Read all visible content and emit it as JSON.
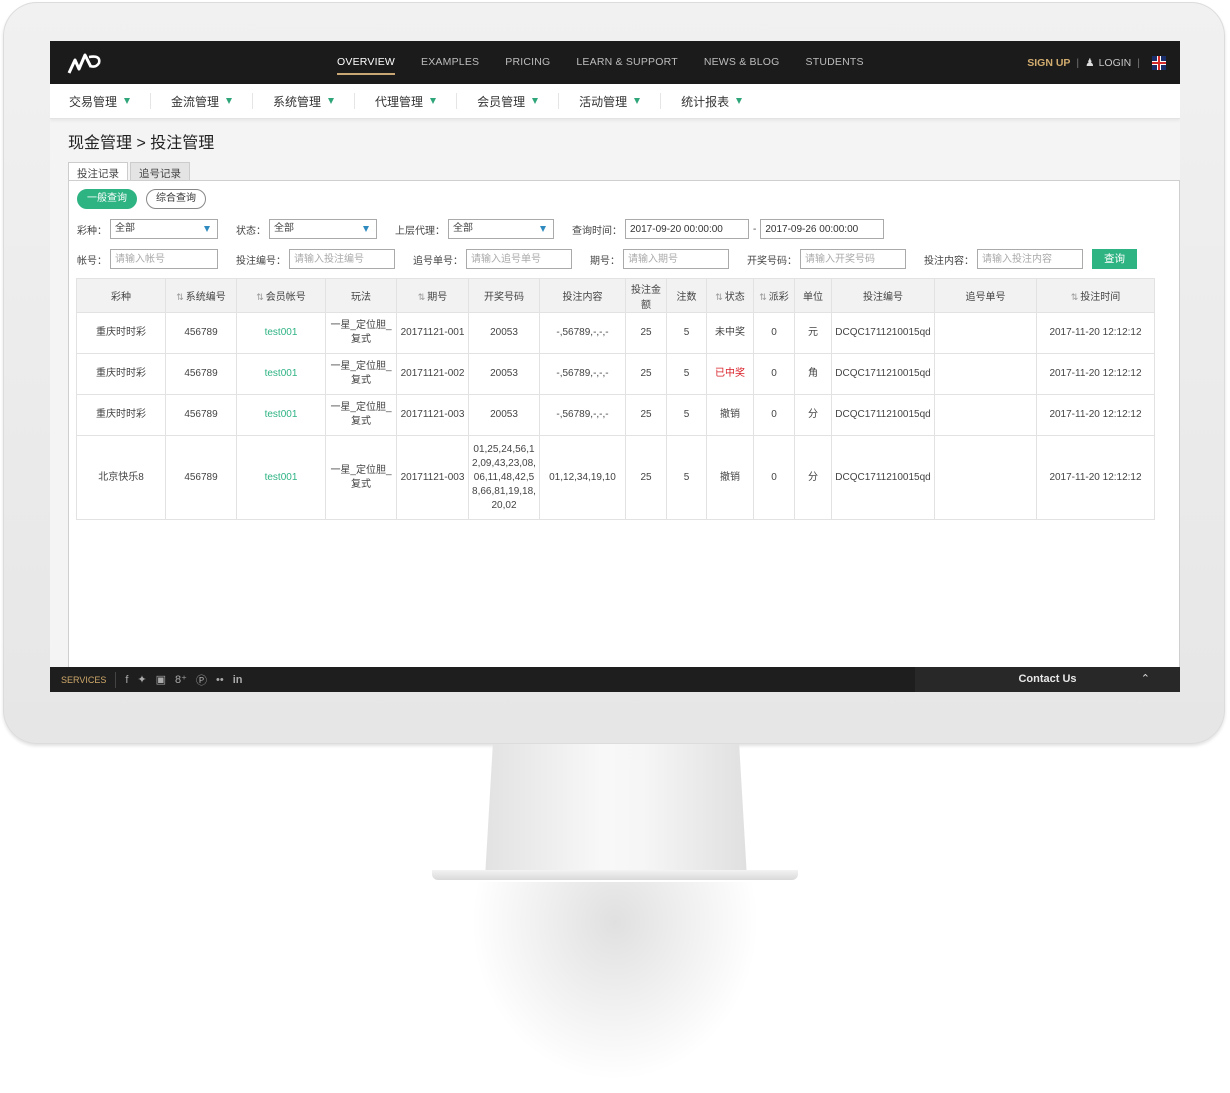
{
  "topnav": {
    "menu": [
      "OVERVIEW",
      "EXAMPLES",
      "PRICING",
      "LEARN & SUPPORT",
      "NEWS & BLOG",
      "STUDENTS"
    ],
    "signup": "SIGN UP",
    "login": "LOGIN"
  },
  "subnav": [
    "交易管理",
    "金流管理",
    "系统管理",
    "代理管理",
    "会员管理",
    "活动管理",
    "统计报表"
  ],
  "breadcrumb": "现金管理 > 投注管理",
  "tabs": [
    "投注记录",
    "追号记录"
  ],
  "query_types": [
    "一般查询",
    "综合查询"
  ],
  "filters": {
    "lottery_label": "彩种：",
    "lottery_value": "全部",
    "status_label": "状态：",
    "status_value": "全部",
    "agent_label": "上层代理：",
    "agent_value": "全部",
    "time_label": "查询时间：",
    "time_from": "2017-09-20 00:00:00",
    "time_sep": "-",
    "time_to": "2017-09-26 00:00:00",
    "account_label": "帐号：",
    "account_ph": "请输入帐号",
    "betno_label": "投注编号：",
    "betno_ph": "请输入投注编号",
    "chase_label": "追号单号：",
    "chase_ph": "请输入追号单号",
    "issue_label": "期号：",
    "issue_ph": "请输入期号",
    "draw_label": "开奖号码：",
    "draw_ph": "请输入开奖号码",
    "content_label": "投注内容：",
    "content_ph": "请输入投注内容",
    "search_btn": "查询"
  },
  "table": {
    "headers": [
      "彩种",
      "系统编号",
      "会员帐号",
      "玩法",
      "期号",
      "开奖号码",
      "投注内容",
      "投注金额",
      "注数",
      "状态",
      "派彩",
      "单位",
      "投注编号",
      "追号单号",
      "投注时间"
    ],
    "rows": [
      {
        "lottery": "重庆时时彩",
        "sys": "456789",
        "member": "test001",
        "play": "一星_定位胆_复式",
        "issue": "20171121-001",
        "draw": "20053",
        "content": "-,56789,-,-,-",
        "amount": "25",
        "count": "5",
        "status": "未中奖",
        "payout": "0",
        "unit": "元",
        "betno": "DCQC1711210015qd",
        "chase": "",
        "time": "2017-11-20 12:12:12"
      },
      {
        "lottery": "重庆时时彩",
        "sys": "456789",
        "member": "test001",
        "play": "一星_定位胆_复式",
        "issue": "20171121-002",
        "draw": "20053",
        "content": "-,56789,-,-,-",
        "amount": "25",
        "count": "5",
        "status": "已中奖",
        "payout": "0",
        "unit": "角",
        "betno": "DCQC1711210015qd",
        "chase": "",
        "time": "2017-11-20 12:12:12"
      },
      {
        "lottery": "重庆时时彩",
        "sys": "456789",
        "member": "test001",
        "play": "一星_定位胆_复式",
        "issue": "20171121-003",
        "draw": "20053",
        "content": "-,56789,-,-,-",
        "amount": "25",
        "count": "5",
        "status": "撤销",
        "payout": "0",
        "unit": "分",
        "betno": "DCQC1711210015qd",
        "chase": "",
        "time": "2017-11-20 12:12:12"
      },
      {
        "lottery": "北京快乐8",
        "sys": "456789",
        "member": "test001",
        "play": "一星_定位胆_复式",
        "issue": "20171121-003",
        "draw": "01,25,24,56,12,09,43,23,08,06,11,48,42,58,66,81,19,18,20,02",
        "content": "01,12,34,19,10",
        "amount": "25",
        "count": "5",
        "status": "撤销",
        "payout": "0",
        "unit": "分",
        "betno": "DCQC1711210015qd",
        "chase": "",
        "time": "2017-11-20 12:12:12"
      }
    ]
  },
  "footer": {
    "services": "SERVICES",
    "social": [
      "f",
      "twitter",
      "instagram",
      "g+",
      "pinterest",
      "flickr",
      "in"
    ],
    "contact": "Contact Us"
  },
  "colors": {
    "accent": "#2eb383",
    "gold": "#d2ac6f",
    "win": "#d9222a"
  }
}
